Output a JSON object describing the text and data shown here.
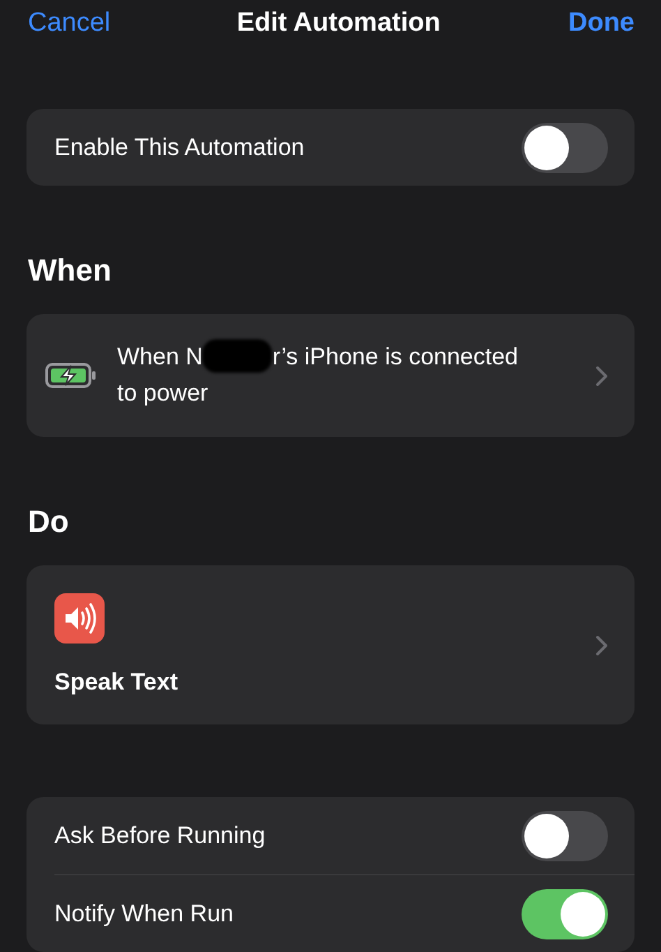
{
  "nav": {
    "cancel": "Cancel",
    "title": "Edit Automation",
    "done": "Done"
  },
  "enable": {
    "label": "Enable This Automation",
    "on": false
  },
  "when": {
    "heading": "When",
    "text_before": "When N",
    "redacted": true,
    "text_after": "r’s iPhone is connected",
    "line_2": "to power"
  },
  "do": {
    "heading": "Do",
    "action": "Speak Text"
  },
  "options": [
    {
      "label": "Ask Before Running",
      "on": false
    },
    {
      "label": "Notify When Run",
      "on": true
    }
  ]
}
